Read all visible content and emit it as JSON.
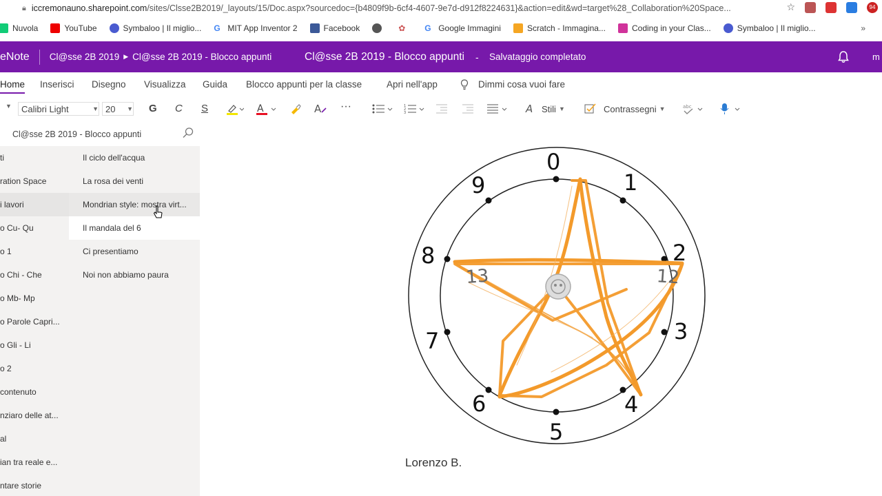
{
  "browser": {
    "url_host": "iccremonauno.sharepoint.com",
    "url_rest": "/sites/Clsse2B2019/_layouts/15/Doc.aspx?sourcedoc={b4809f9b-6cf4-4607-9e7d-d912f8224631}&action=edit&wd=target%28_Collaboration%20Space...",
    "ext_badge": "94",
    "bookmarks": [
      "Nuvola",
      "YouTube",
      "Symbaloo | Il miglio...",
      "MIT App Inventor 2",
      "Facebook",
      "",
      "",
      "Google Immagini",
      "Scratch - Immagina...",
      "Coding in your Clas...",
      "Symbaloo | Il miglio..."
    ],
    "more": "»"
  },
  "header": {
    "app": "eNote",
    "breadcrumb_notebook": "Cl@sse 2B 2019",
    "breadcrumb_section": "Cl@sse 2B 2019 - Blocco appunti",
    "title": "Cl@sse 2B 2019 - Blocco appunti",
    "dash": "-",
    "status": "Salvataggio completato",
    "user": "m"
  },
  "tabs": [
    "Home",
    "Inserisci",
    "Disegno",
    "Visualizza",
    "Guida",
    "Blocco appunti per la classe",
    "Apri nell'app",
    "Dimmi cosa vuoi fare"
  ],
  "toolbar": {
    "font": "Calibri Light",
    "size": "20",
    "bold": "G",
    "italic": "C",
    "underline": "S",
    "styles": "Stili",
    "tags": "Contrassegni",
    "more": "···"
  },
  "notebook_search": "Cl@sse 2B 2019 - Blocco appunti",
  "sections": [
    "ti",
    "ration Space",
    "i lavori",
    "o Cu- Qu",
    "o 1",
    "o Chi - Che",
    "o Mb- Mp",
    "o Parole Capri...",
    "o Gli - Li",
    "o 2",
    "contenuto",
    "nziaro delle at...",
    "al",
    "ian tra reale e...",
    "ntare storie"
  ],
  "pages": [
    "Il ciclo dell'acqua",
    "La rosa dei venti",
    "Mondrian style: mostra virt...",
    "Il mandala del 6",
    "Ci presentiamo",
    "Noi non abbiamo paura"
  ],
  "drawing": {
    "numbers": [
      "0",
      "1",
      "2",
      "3",
      "4",
      "5",
      "6",
      "7",
      "8",
      "9"
    ],
    "marks": [
      "12",
      "13"
    ],
    "stroke_color": "#f39a2b"
  },
  "signature": "Lorenzo B.",
  "colors": {
    "accent": "#7719aa",
    "pane": "#f3f2f1"
  }
}
